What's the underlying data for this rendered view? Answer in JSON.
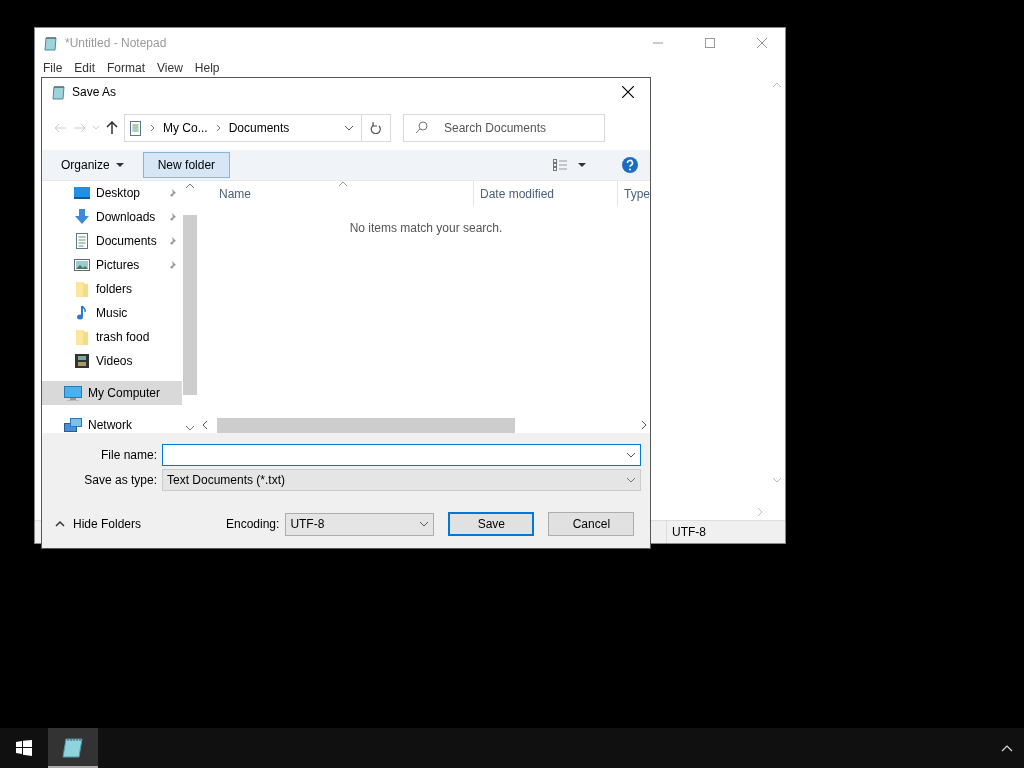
{
  "notepad": {
    "title": "*Untitled - Notepad",
    "menu": [
      "File",
      "Edit",
      "Format",
      "View",
      "Help"
    ],
    "status_bar": {
      "encoding": "UTF-8"
    }
  },
  "dialog": {
    "title": "Save As",
    "path": [
      "My Co...",
      "Documents"
    ],
    "search": {
      "placeholder": "Search Documents"
    },
    "toolbar": {
      "organize": "Organize",
      "new_folder": {
        "label": "New folder",
        "hovered": true
      }
    },
    "nav_items": [
      {
        "label": "Desktop",
        "kind": "desktop",
        "pinned": true,
        "selected": false
      },
      {
        "label": "Downloads",
        "kind": "downloads",
        "pinned": true,
        "selected": false
      },
      {
        "label": "Documents",
        "kind": "documents",
        "pinned": true,
        "selected": false
      },
      {
        "label": "Pictures",
        "kind": "pictures",
        "pinned": true,
        "selected": false
      },
      {
        "label": "folders",
        "kind": "folder",
        "pinned": false,
        "selected": false
      },
      {
        "label": "Music",
        "kind": "music",
        "pinned": false,
        "selected": false
      },
      {
        "label": "trash food",
        "kind": "folder",
        "pinned": false,
        "selected": false
      },
      {
        "label": "Videos",
        "kind": "videos",
        "pinned": false,
        "selected": false
      },
      {
        "label": "My Computer",
        "kind": "computer",
        "pinned": false,
        "selected": true
      },
      {
        "label": "Network",
        "kind": "network",
        "pinned": false,
        "selected": false
      }
    ],
    "columns": [
      "Name",
      "Date modified",
      "Type"
    ],
    "empty_message": "No items match your search.",
    "file_name": {
      "label": "File name:"
    },
    "save_type": {
      "label": "Save as type:",
      "value": "Text Documents (*.txt)"
    },
    "hide_folders": "Hide Folders",
    "encoding": {
      "label": "Encoding:",
      "value": "UTF-8"
    },
    "buttons": [
      {
        "label": "Save",
        "default": true
      },
      {
        "label": "Cancel",
        "default": false
      }
    ]
  },
  "taskbar": {
    "apps": [
      {
        "kind": "notepad",
        "active": true
      }
    ]
  }
}
